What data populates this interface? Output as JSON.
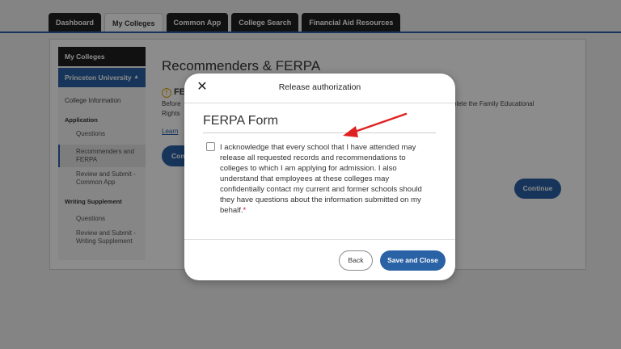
{
  "tabs": [
    "Dashboard",
    "My Colleges",
    "Common App",
    "College Search",
    "Financial Aid Resources"
  ],
  "sidebar": {
    "header": "My Colleges",
    "school": "Princeton University",
    "college_information": "College Information",
    "application_section": "Application",
    "application_items": [
      "Questions",
      "Recommenders and FERPA",
      "Review and Submit - Common App"
    ],
    "writing_section": "Writing Supplement",
    "writing_items": [
      "Questions",
      "Review and Submit - Writing Supplement"
    ]
  },
  "content": {
    "title": "Recommenders & FERPA",
    "warning_heading": "FE",
    "text_left_1": "Before",
    "text_right_1": "plete the Family Educational",
    "text_left_2": "Rights",
    "learn_more": "Learn",
    "continue_left": "Con",
    "continue_right": "Continue"
  },
  "modal": {
    "title": "Release authorization",
    "form_title": "FERPA Form",
    "acknowledgement": "I acknowledge that every school that I have attended may release all requested records and recommendations to colleges to which I am applying for admission. I also understand that employees at these colleges may confidentially contact my current and former schools should they have questions about the information submitted on my behalf.",
    "required_marker": "*",
    "back_label": "Back",
    "save_label": "Save and Close"
  },
  "colors": {
    "accent": "#2a62a6",
    "annotation_arrow": "#e02020"
  },
  "icons": {
    "close": "close-icon",
    "warning": "warning-icon",
    "caret": "caret-up-icon"
  }
}
